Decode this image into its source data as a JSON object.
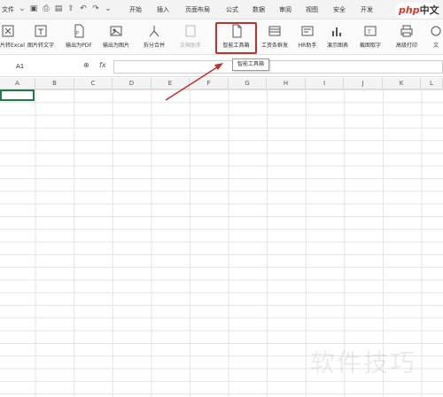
{
  "menu": {
    "file": "文件"
  },
  "tabs": [
    "开始",
    "插入",
    "页面布局",
    "公式",
    "数据",
    "审阅",
    "视图",
    "安全",
    "开发"
  ],
  "logo": {
    "part1": "php",
    "part2": "中文网"
  },
  "ribbon": [
    {
      "label": "图片转Excel",
      "icon": "excel-icon"
    },
    {
      "label": "图片转文字",
      "icon": "ocr-icon"
    },
    {
      "label": "输出为PDF",
      "icon": "pdf-icon"
    },
    {
      "label": "输出为图片",
      "icon": "image-icon"
    },
    {
      "label": "拆分合并",
      "icon": "split-icon"
    },
    {
      "label": "文档助手",
      "icon": "doc-icon"
    },
    {
      "label": "智能工具箱",
      "icon": "toolbox-icon"
    },
    {
      "label": "工资条群发",
      "icon": "salary-icon"
    },
    {
      "label": "HR助手",
      "icon": "hr-icon"
    },
    {
      "label": "演示图表",
      "icon": "chart-icon"
    },
    {
      "label": "截图取字",
      "icon": "screenshot-icon"
    },
    {
      "label": "高级打印",
      "icon": "print-icon"
    },
    {
      "label": "文",
      "icon": "more-icon"
    }
  ],
  "formula_bar": {
    "cell_ref": "A1",
    "fx": "fx",
    "value": ""
  },
  "tooltip": "智能工具箱",
  "columns": [
    "A",
    "B",
    "C",
    "D",
    "E",
    "F",
    "G",
    "H",
    "I",
    "J",
    "K",
    "L"
  ],
  "watermark": "软件技巧",
  "colors": {
    "highlight": "#c0302d",
    "active_cell": "#1e7b45",
    "arrow": "#c0302d"
  }
}
